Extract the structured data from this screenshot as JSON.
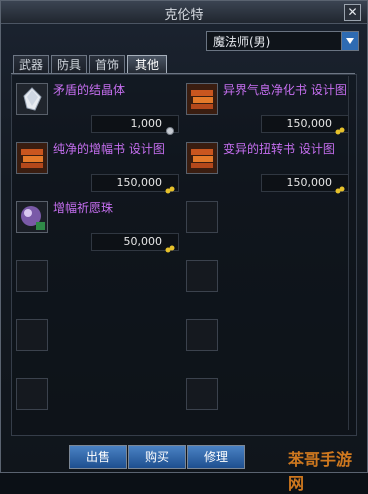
{
  "window": {
    "title": "克伦特"
  },
  "class_select": {
    "value": "魔法师(男)"
  },
  "tabs": [
    {
      "label": "武器",
      "active": false
    },
    {
      "label": "防具",
      "active": false
    },
    {
      "label": "首饰",
      "active": false
    },
    {
      "label": "其他",
      "active": true
    }
  ],
  "items": [
    {
      "name": "矛盾的结晶体",
      "price": "1,000",
      "icon": "crystal-icon",
      "currency_icon": "silver-coin-icon"
    },
    {
      "name": "异界气息净化书 设计图",
      "price": "150,000",
      "icon": "scroll-icon",
      "currency_icon": "gold-coin-icon"
    },
    {
      "name": "纯净的增幅书 设计图",
      "price": "150,000",
      "icon": "scroll-icon",
      "currency_icon": "gold-coin-icon"
    },
    {
      "name": "变异的扭转书 设计图",
      "price": "150,000",
      "icon": "scroll-icon",
      "currency_icon": "gold-coin-icon"
    },
    {
      "name": "增幅祈愿珠",
      "price": "50,000",
      "icon": "orb-icon",
      "currency_icon": "gold-coin-icon"
    }
  ],
  "actions": {
    "sell": "出售",
    "buy": "购买",
    "repair": "修理"
  },
  "watermark": "苯哥手游网"
}
